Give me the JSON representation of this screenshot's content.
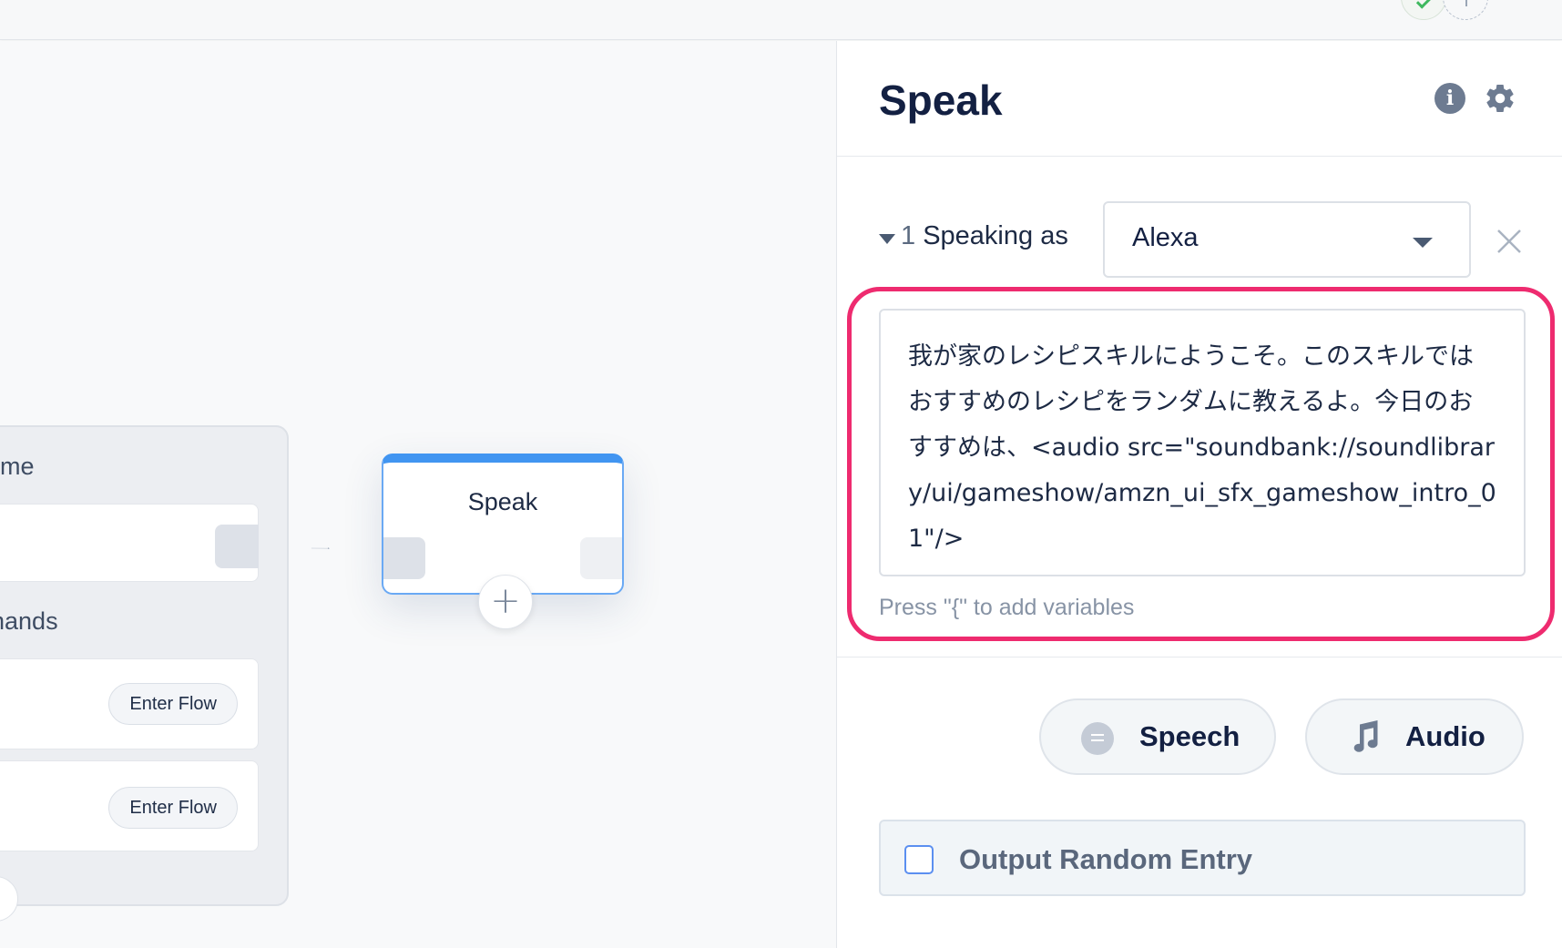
{
  "canvas": {
    "block": {
      "section1_title_fragment": "me",
      "section2_title_fragment": "nands",
      "commands": [
        {
          "button_label": "Enter Flow"
        },
        {
          "button_label": "Enter Flow"
        }
      ]
    },
    "speak_node": {
      "title": "Speak"
    }
  },
  "panel": {
    "title": "Speak",
    "speaking_row": {
      "index": "1",
      "label": "Speaking as",
      "voice_value": "Alexa"
    },
    "message_text": "我が家のレシピスキルにようこそ。このスキルではおすすめのレシピをランダムに教えるよ。今日のおすすめは、<audio src=\"soundbank://soundlibrary/ui/gameshow/amzn_ui_sfx_gameshow_intro_01\"/>",
    "hint": "Press \"{\" to add variables",
    "add_buttons": {
      "speech_label": "Speech",
      "audio_label": "Audio"
    },
    "random_entry_label": "Output Random Entry",
    "random_entry_checked": false
  },
  "colors": {
    "highlight": "#ee2b6f",
    "node_accent": "#4195f1",
    "checkbox": "#5b8ff0"
  },
  "icons": [
    "info-icon",
    "gear-icon",
    "close-icon",
    "chevron-down-icon",
    "speech-bubble-icon",
    "music-note-icon",
    "plus-icon",
    "check-icon"
  ]
}
